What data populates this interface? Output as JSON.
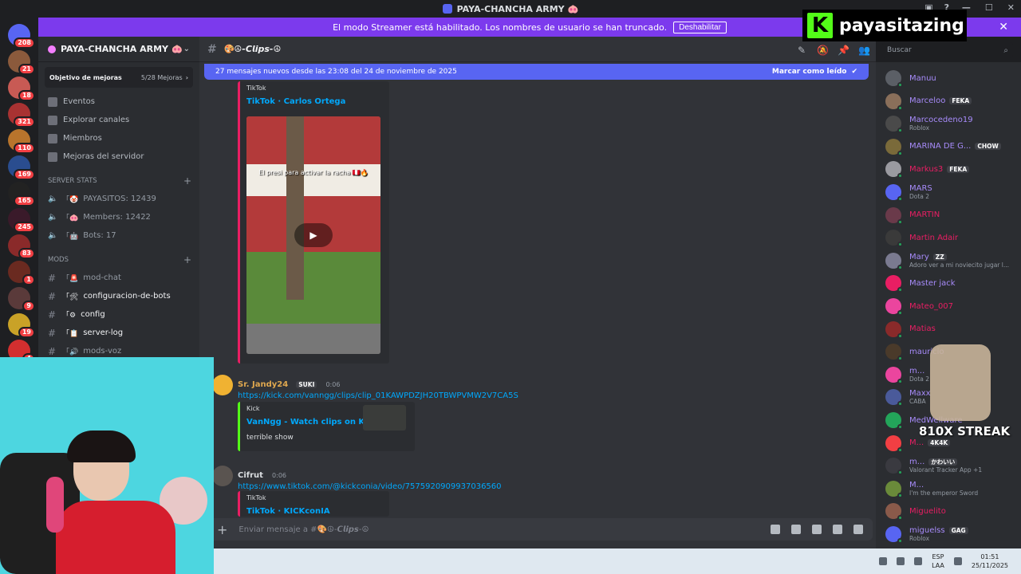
{
  "window": {
    "title": "PAYA-CHANCHA ARMY",
    "title_emoji": "🐽",
    "controls": [
      "—",
      "☐",
      "✕"
    ]
  },
  "banner": {
    "text": "El modo Streamer está habilitado. Los nombres de usuario se han truncado.",
    "button": "Deshabilitar"
  },
  "rail": {
    "badges": [
      "208",
      "21",
      "18",
      "321",
      "110",
      "169",
      "165",
      "245",
      "83",
      "1",
      "9",
      "19",
      "4"
    ]
  },
  "sidebar": {
    "server_name": "PAYA-CHANCHA ARMY",
    "server_emoji": "🐽",
    "boost_label": "Objetivo de mejoras",
    "boost_count": "5/28 Mejoras",
    "nav": [
      "Eventos",
      "Explorar canales",
      "Miembros",
      "Mejoras del servidor"
    ],
    "server_stats_label": "SERVER STATS",
    "stats": [
      "PAYASITOS: 12439",
      "Members: 12422",
      "Bots: 17"
    ],
    "mods_label": "Mods",
    "channels": [
      "mod-chat",
      "configuracion-de-bots",
      "config",
      "server-log",
      "mods-voz"
    ]
  },
  "chat": {
    "channel_name": "𝘾𝙡𝙞𝙥𝙨",
    "channel_prefix": "🎨☮-",
    "channel_suffix": "-☮",
    "new_messages": "27 mensajes nuevos desde las 23:08 del 24 de noviembre de 2025",
    "mark_read": "Marcar como leído",
    "embed1": {
      "provider": "TikTok",
      "title": "TikTok · Carlos Ortega",
      "caption": "El presi para activar la racha 🇵🇪🔥"
    },
    "msg2": {
      "user": "Sr. Jandy24",
      "tag": "SUKI",
      "time": "0:06",
      "link": "https://kick.com/vanngg/clips/clip_01KAWPDZJH20TBWPVMW2V7CA5S",
      "embed_provider": "Kick",
      "embed_title": "VanNgg - Watch clips on Kick",
      "embed_desc": "terrible show"
    },
    "msg3": {
      "user": "Cifrut",
      "time": "0:06",
      "link": "https://www.tiktok.com/@kickconia/video/7575920909937036560",
      "embed_provider": "TikTok",
      "embed_title": "TikTok · KICKconIA"
    },
    "composer_placeholder": "Enviar mensaje a #🎨☮-𝘾𝙡𝙞𝙥𝙨-☮"
  },
  "search": {
    "placeholder": "Buscar"
  },
  "members": [
    {
      "name": "Manuu",
      "status": "",
      "color": "#a78bfa"
    },
    {
      "name": "Marceloo",
      "status": "",
      "tag": "FEKA",
      "color": "#a78bfa"
    },
    {
      "name": "Marcocedeno19",
      "status": "Roblox",
      "color": "#a78bfa"
    },
    {
      "name": "MARINA DE G...",
      "status": "",
      "tag": "CHOW",
      "color": "#a78bfa"
    },
    {
      "name": "Markus3",
      "status": "",
      "tag": "FEKA",
      "color": "#e91e63"
    },
    {
      "name": "MARS",
      "status": "Dota 2",
      "color": "#a78bfa"
    },
    {
      "name": "MARTIN",
      "status": "",
      "color": "#e91e63"
    },
    {
      "name": "Martin Adair",
      "status": "",
      "color": "#e91e63"
    },
    {
      "name": "Mary",
      "status": "Adoro ver a mi noviecito jugar l...",
      "tag": "ZZ",
      "color": "#a78bfa"
    },
    {
      "name": "Master jack",
      "status": "",
      "color": "#a78bfa"
    },
    {
      "name": "Mateo_007",
      "status": "",
      "color": "#e91e63"
    },
    {
      "name": "Matias",
      "status": "",
      "color": "#e91e63"
    },
    {
      "name": "mauricio",
      "status": "",
      "color": "#a78bfa"
    },
    {
      "name": "m...",
      "status": "Dota 2",
      "color": "#a78bfa"
    },
    {
      "name": "Maxx",
      "status": "CABA",
      "color": "#a78bfa"
    },
    {
      "name": "MedWellware",
      "status": "",
      "color": "#a78bfa"
    },
    {
      "name": "M...",
      "status": "",
      "tag": "4K4K",
      "color": "#e91e63"
    },
    {
      "name": "m...",
      "status": "Valorant Tracker App +1",
      "tag": "かわいい",
      "color": "#a78bfa"
    },
    {
      "name": "M...",
      "status": "I'm the emperor Sword",
      "color": "#a78bfa"
    },
    {
      "name": "Miguelito",
      "status": "",
      "color": "#e91e63"
    },
    {
      "name": "miguelss",
      "status": "Roblox",
      "tag": "GAG",
      "color": "#a78bfa"
    }
  ],
  "overlay": {
    "kick_name": "payasitazing",
    "streak": "810X STREAK"
  },
  "taskbar": {
    "lang": "ESP",
    "lang2": "LAA",
    "time": "01:51",
    "date": "25/11/2025"
  },
  "colors": {
    "banner": "#7c3aed",
    "new_bar": "#5865f2",
    "link": "#00a8fc",
    "kick_green": "#53fc18",
    "badge_red": "#f23f43",
    "online": "#23a55a"
  }
}
